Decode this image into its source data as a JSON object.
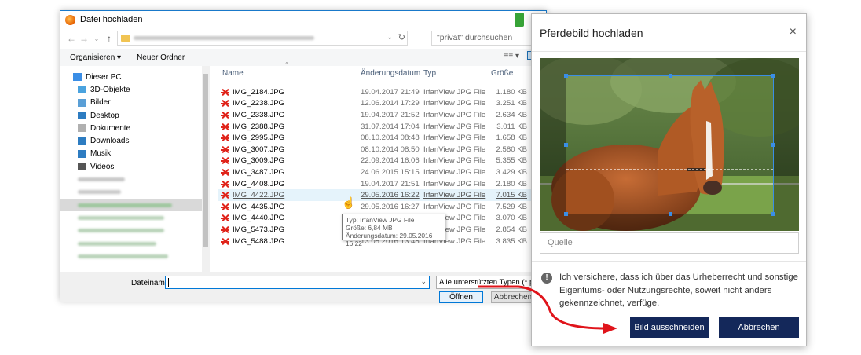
{
  "file_dialog": {
    "title": "Datei hochladen",
    "search_placeholder": "\"privat\" durchsuchen",
    "toolbar": {
      "organize": "Organisieren ▾",
      "new_folder": "Neuer Ordner",
      "view_icon": "≡≡ ▾"
    },
    "nav_items": [
      {
        "label": "Dieser PC",
        "color": "#3a8ee6"
      },
      {
        "label": "3D-Objekte",
        "color": "#4aa3df"
      },
      {
        "label": "Bilder",
        "color": "#5a9fd6"
      },
      {
        "label": "Desktop",
        "color": "#2d7cc1"
      },
      {
        "label": "Dokumente",
        "color": "#b0b0b0"
      },
      {
        "label": "Downloads",
        "color": "#2d7cc1"
      },
      {
        "label": "Musik",
        "color": "#2d7cc1"
      },
      {
        "label": "Videos",
        "color": "#555555"
      }
    ],
    "columns": {
      "name": "Name",
      "date": "Änderungsdatum",
      "type": "Typ",
      "size": "Größe"
    },
    "files": [
      {
        "name": "IMG_2184.JPG",
        "date": "19.04.2017 21:49",
        "type": "IrfanView JPG File",
        "size": "1.180 KB"
      },
      {
        "name": "IMG_2238.JPG",
        "date": "12.06.2014 17:29",
        "type": "IrfanView JPG File",
        "size": "3.251 KB"
      },
      {
        "name": "IMG_2338.JPG",
        "date": "19.04.2017 21:52",
        "type": "IrfanView JPG File",
        "size": "2.634 KB"
      },
      {
        "name": "IMG_2388.JPG",
        "date": "31.07.2014 17:04",
        "type": "IrfanView JPG File",
        "size": "3.011 KB"
      },
      {
        "name": "IMG_2995.JPG",
        "date": "08.10.2014 08:48",
        "type": "IrfanView JPG File",
        "size": "1.658 KB"
      },
      {
        "name": "IMG_3007.JPG",
        "date": "08.10.2014 08:50",
        "type": "IrfanView JPG File",
        "size": "2.580 KB"
      },
      {
        "name": "IMG_3009.JPG",
        "date": "22.09.2014 16:06",
        "type": "IrfanView JPG File",
        "size": "5.355 KB"
      },
      {
        "name": "IMG_3487.JPG",
        "date": "24.06.2015 15:15",
        "type": "IrfanView JPG File",
        "size": "3.429 KB"
      },
      {
        "name": "IMG_4408.JPG",
        "date": "19.04.2017 21:51",
        "type": "IrfanView JPG File",
        "size": "2.180 KB"
      },
      {
        "name": "IMG_4422.JPG",
        "date": "29.05.2016 16:22",
        "type": "IrfanView JPG File",
        "size": "7.015 KB"
      },
      {
        "name": "IMG_4435.JPG",
        "date": "29.05.2016 16:27",
        "type": "IrfanView JPG File",
        "size": "7.529 KB"
      },
      {
        "name": "IMG_4440.JPG",
        "date": "19.04.2017 21:51",
        "type": "IrfanView JPG File",
        "size": "3.070 KB"
      },
      {
        "name": "IMG_5473.JPG",
        "date": "19.04.2017 21:52",
        "type": "IrfanView JPG File",
        "size": "2.854 KB"
      },
      {
        "name": "IMG_5488.JPG",
        "date": "13.08.2016 13:48",
        "type": "IrfanView JPG File",
        "size": "3.835 KB"
      }
    ],
    "tooltip": {
      "line1": "Typ: IrfanView JPG File",
      "line2": "Größe: 6,84 MB",
      "line3": "Änderungsdatum: 29.05.2016 16:22"
    },
    "filename_label": "Dateiname:",
    "filter_value": "Alle unterstützten Typen (*.png",
    "open_button": "Öffnen",
    "cancel_button": "Abbrechen"
  },
  "modal": {
    "title": "Pferdebild hochladen",
    "close": "×",
    "source_placeholder": "Quelle",
    "info_text": "Ich versichere, dass ich über das Urheberrecht und sonstige Eigentums- oder Nutzungsrechte, soweit nicht anders gekennzeichnet, verfüge.",
    "crop_button": "Bild ausschneiden",
    "cancel_button": "Abbrechen"
  },
  "colors": {
    "primary_button": "#14285a",
    "annotation_arrow": "#e0141b",
    "accent": "#0078d7"
  }
}
